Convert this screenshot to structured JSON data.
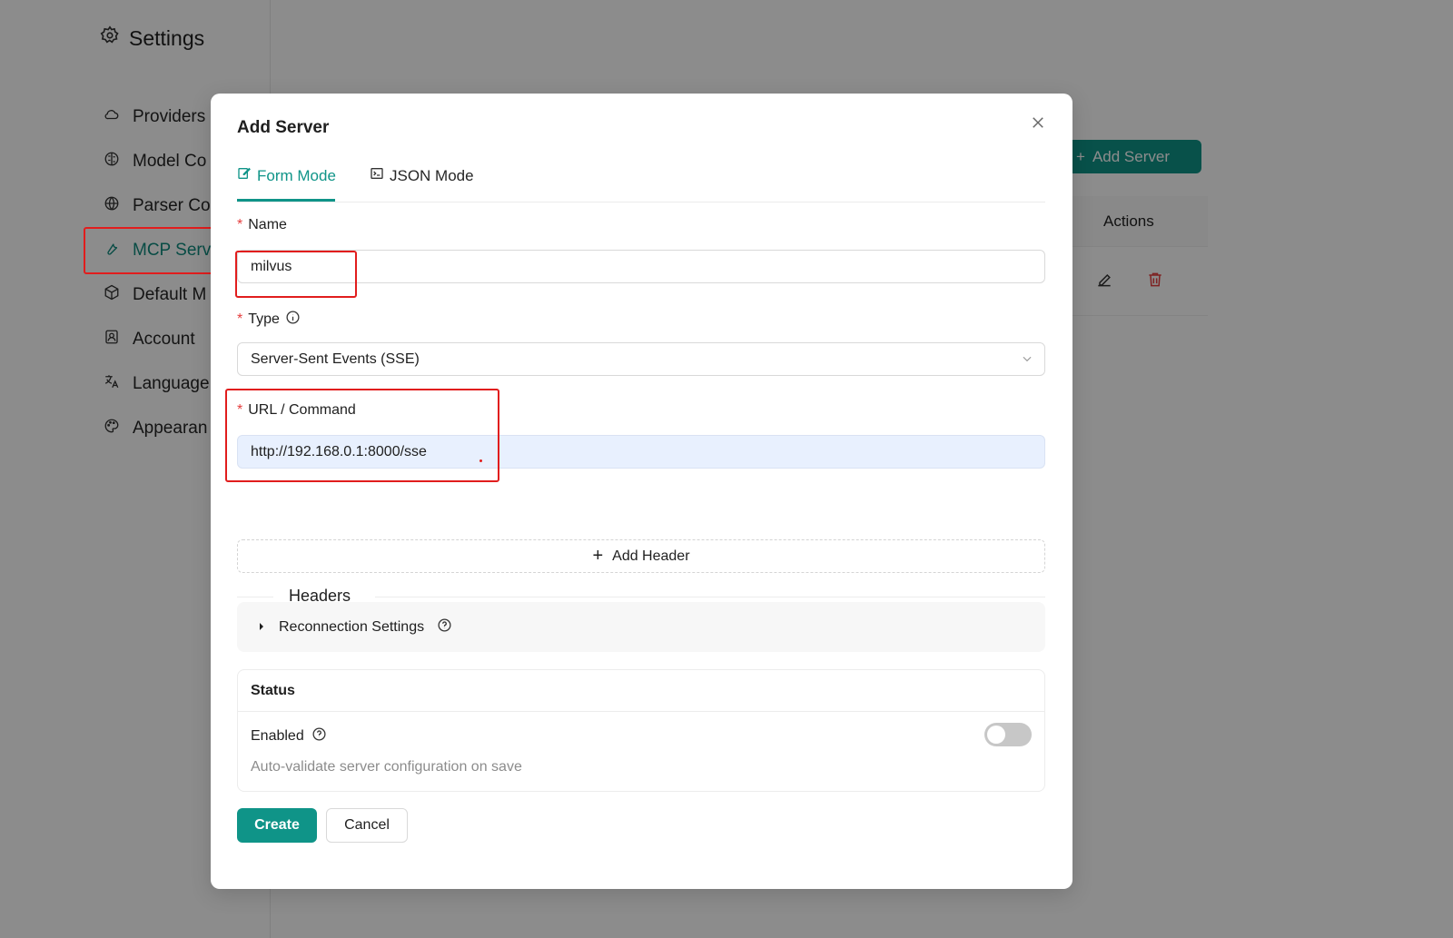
{
  "page": {
    "title": "Settings",
    "nav": [
      {
        "label": "Providers",
        "icon": "cloud-icon"
      },
      {
        "label": "Model Co",
        "icon": "brain-icon"
      },
      {
        "label": "Parser Co",
        "icon": "globe-icon"
      },
      {
        "label": "MCP Serv",
        "icon": "wrench-icon",
        "active": true
      },
      {
        "label": "Default M",
        "icon": "box-icon"
      },
      {
        "label": "Account",
        "icon": "user-card-icon"
      },
      {
        "label": "Language",
        "icon": "translate-icon"
      },
      {
        "label": "Appearan",
        "icon": "palette-icon"
      }
    ],
    "add_server_label": "Add Server",
    "table_actions_header": "Actions"
  },
  "modal": {
    "title": "Add Server",
    "tabs": [
      {
        "label": "Form Mode",
        "icon": "edit-icon",
        "active": true
      },
      {
        "label": "JSON Mode",
        "icon": "terminal-icon"
      }
    ],
    "fields": {
      "name": {
        "label": "Name",
        "required": true,
        "value": "milvus"
      },
      "type": {
        "label": "Type",
        "required": true,
        "value": "Server-Sent Events (SSE)"
      },
      "url": {
        "label": "URL / Command",
        "required": true,
        "value": "http://192.168.0.1:8000/sse"
      }
    },
    "headers_section": "Headers",
    "add_header_label": "Add Header",
    "reconnection_label": "Reconnection Settings",
    "status": {
      "title": "Status",
      "enabled_label": "Enabled",
      "enabled": false,
      "help": "Auto-validate server configuration on save"
    },
    "create_label": "Create",
    "cancel_label": "Cancel"
  },
  "colors": {
    "accent": "#0f9488",
    "required": "#e53e3e",
    "highlight": "#e11d1d"
  }
}
